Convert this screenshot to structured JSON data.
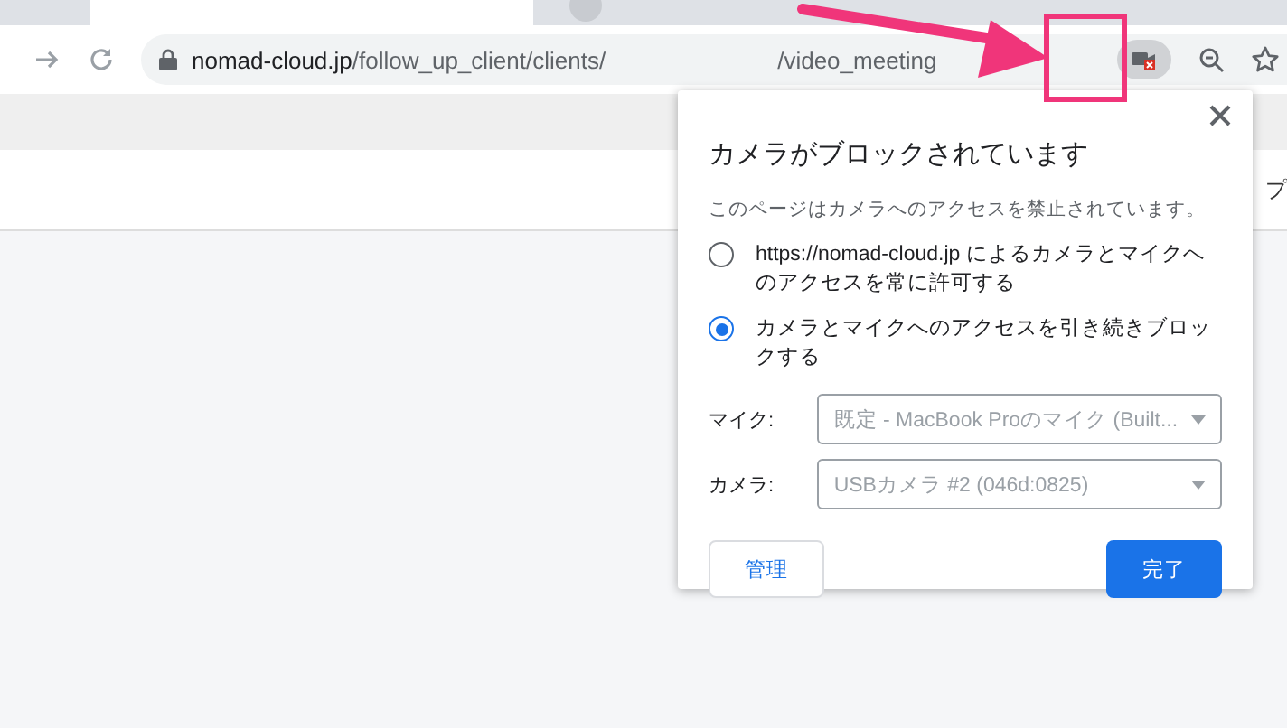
{
  "browser": {
    "url": {
      "host": "nomad-cloud.jp",
      "path": "/follow_up_client/clients/",
      "suffix": "/video_meeting"
    }
  },
  "page": {
    "header_text": "プ"
  },
  "popup": {
    "title": "カメラがブロックされています",
    "message": "このページはカメラへのアクセスを禁止されています。",
    "options": [
      {
        "label": "https://nomad-cloud.jp によるカメラとマイクへのアクセスを常に許可する",
        "selected": false
      },
      {
        "label": "カメラとマイクへのアクセスを引き続きブロックする",
        "selected": true
      }
    ],
    "devices": [
      {
        "label": "マイク:",
        "value": "既定 - MacBook Proのマイク (Built..."
      },
      {
        "label": "カメラ:",
        "value": "USBカメラ #2 (046d:0825)"
      }
    ],
    "buttons": [
      {
        "label": "管理",
        "kind": "secondary"
      },
      {
        "label": "完了",
        "kind": "primary"
      }
    ]
  }
}
